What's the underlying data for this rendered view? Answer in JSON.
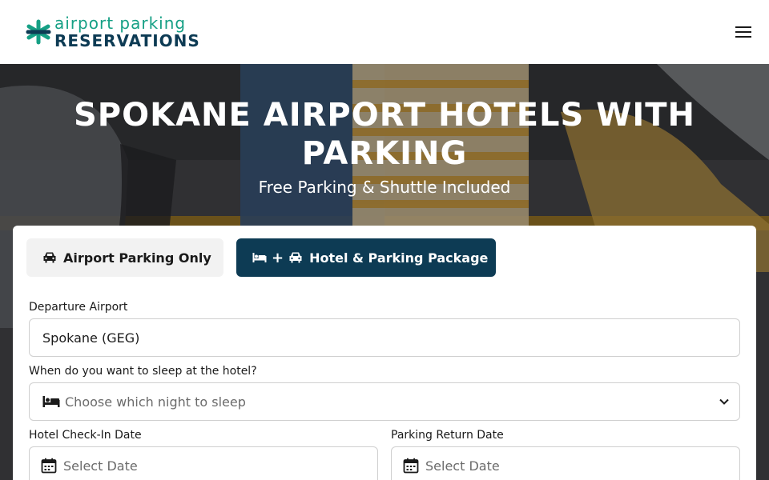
{
  "header": {
    "logo_line1": "airport parking",
    "logo_line2": "RESERVATIONS",
    "menu_icon": "hamburger-icon"
  },
  "hero": {
    "title": "SPOKANE AIRPORT HOTELS WITH PARKING",
    "subtitle": "Free Parking & Shuttle Included"
  },
  "tabs": [
    {
      "label": "Airport Parking Only",
      "icon": "car-icon"
    },
    {
      "label": "Hotel & Parking Package",
      "icons": [
        "bed-icon",
        "plus",
        "car-icon"
      ],
      "plus": "+"
    }
  ],
  "form": {
    "departure_label": "Departure Airport",
    "departure_value": "Spokane (GEG)",
    "sleep_label": "When do you want to sleep at the hotel?",
    "sleep_placeholder": "Choose which night to sleep",
    "checkin_label": "Hotel Check-In Date",
    "checkin_placeholder": "Select Date",
    "return_label": "Parking Return Date",
    "return_placeholder": "Select Date"
  },
  "colors": {
    "brand_dark": "#0d3b54",
    "brand_green": "#16a085"
  }
}
